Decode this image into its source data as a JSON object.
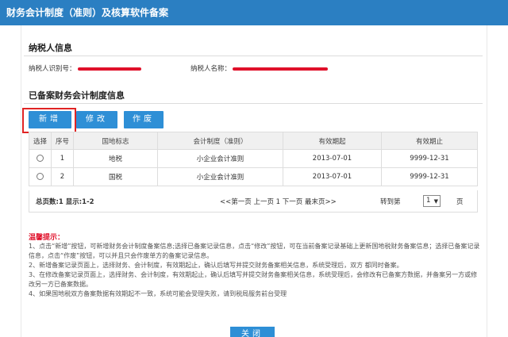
{
  "window": {
    "title": "财务会计制度（准则）及核算软件备案"
  },
  "taxpayer": {
    "section_title": "纳税人信息",
    "id_label": "纳税人识别号：",
    "name_label": "纳税人名称："
  },
  "records": {
    "section_title": "已备案财务会计制度信息",
    "buttons": {
      "add": "新增",
      "edit": "修改",
      "void": "作废"
    },
    "columns": [
      "选择",
      "序号",
      "国地标志",
      "会计制度（准则）",
      "有效期起",
      "有效期止"
    ],
    "rows": [
      {
        "seq": "1",
        "flag": "地税",
        "system": "小企业会计准则",
        "start": "2013-07-01",
        "end": "9999-12-31"
      },
      {
        "seq": "2",
        "flag": "国税",
        "system": "小企业会计准则",
        "start": "2013-07-01",
        "end": "9999-12-31"
      }
    ]
  },
  "pager": {
    "summary": "总页数:1 显示:1-2",
    "nav": "<<第一页 上一页 1 下一页 最末页>>",
    "goto_label": "转到第",
    "page_value": "1",
    "page_suffix": "页"
  },
  "tips": {
    "title": "温馨提示：",
    "lines": [
      "1、点击“新增”按钮，可新增财务会计制度备案信息;选择已备案记录信息，点击“修改”按钮，可在当前备案记录基础上更新国地税财务备案信息；选择已备案记录信息，点击“作废”按钮，可以并且只会作废单方的备案记录信息。",
      "2、新增备案记录页面上，选择财务、会计制度，有效期起止，确认后填写并提交财务备案相关信息，系统受理后，双方 都同时备案。",
      "3、在修改备案记录页面上，选择财务、会计制度，有效期起止，确认后填写并提交财务备案相关信息，系统受理后，会修改有已备案方数据，并备案另一方或修改另一方已备案数据。",
      "4、如果国地税双方备案数据有效期起不一致，系统可能会受理失败，请到税局服务前台受理"
    ]
  },
  "footer": {
    "close": "关闭"
  },
  "colors": {
    "accent": "#2e8fd6",
    "titlebar": "#2b7fc2",
    "highlight": "#e02424",
    "tip_title": "#e0102a"
  }
}
